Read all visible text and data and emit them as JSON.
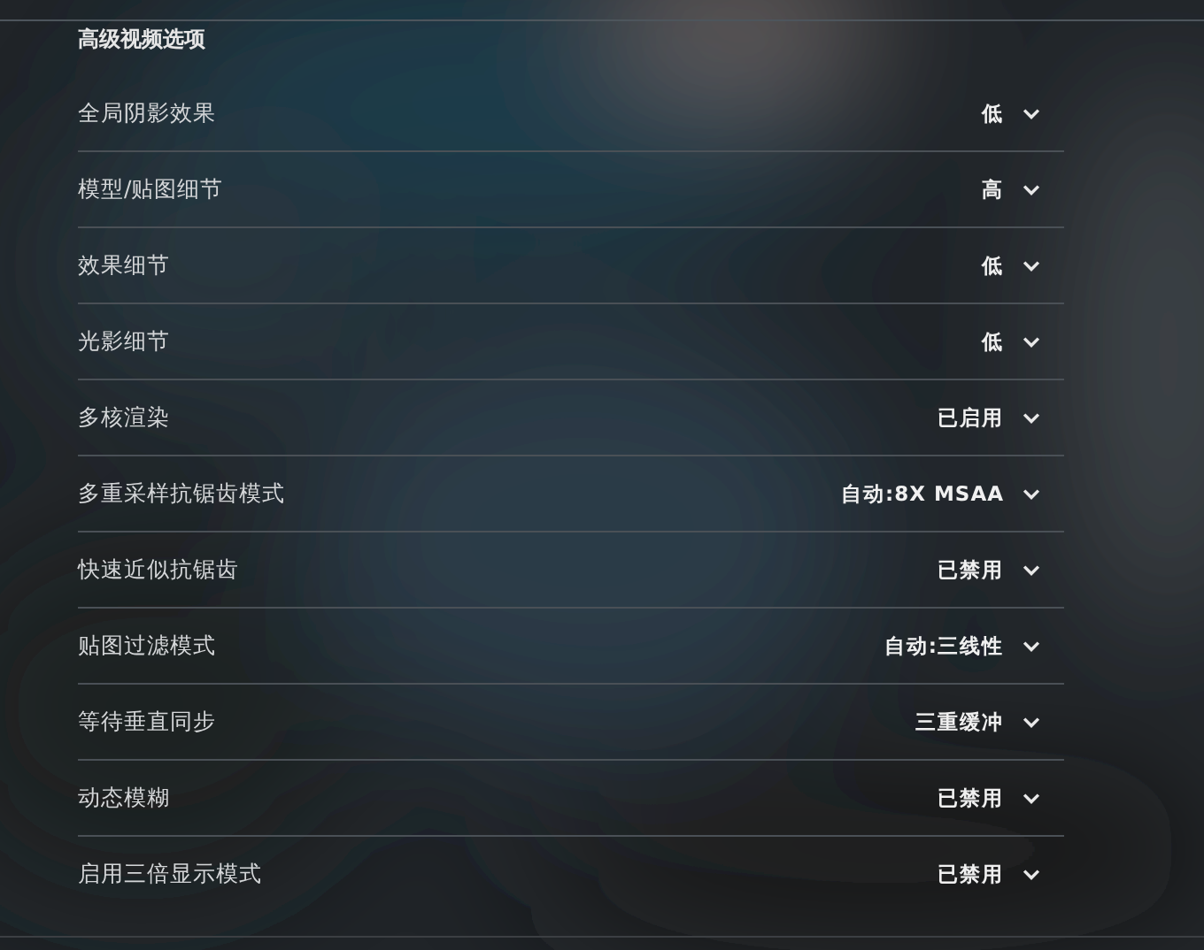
{
  "section_title": "高级视频选项",
  "settings": [
    {
      "label": "全局阴影效果",
      "value": "低"
    },
    {
      "label": "模型/贴图细节",
      "value": "高"
    },
    {
      "label": "效果细节",
      "value": "低"
    },
    {
      "label": "光影细节",
      "value": "低"
    },
    {
      "label": "多核渲染",
      "value": "已启用"
    },
    {
      "label": "多重采样抗锯齿模式",
      "value": "自动:8X MSAA"
    },
    {
      "label": "快速近似抗锯齿",
      "value": "已禁用"
    },
    {
      "label": "贴图过滤模式",
      "value": "自动:三线性"
    },
    {
      "label": "等待垂直同步",
      "value": "三重缓冲"
    },
    {
      "label": "动态模糊",
      "value": "已禁用"
    },
    {
      "label": "启用三倍显示模式",
      "value": "已禁用"
    }
  ]
}
